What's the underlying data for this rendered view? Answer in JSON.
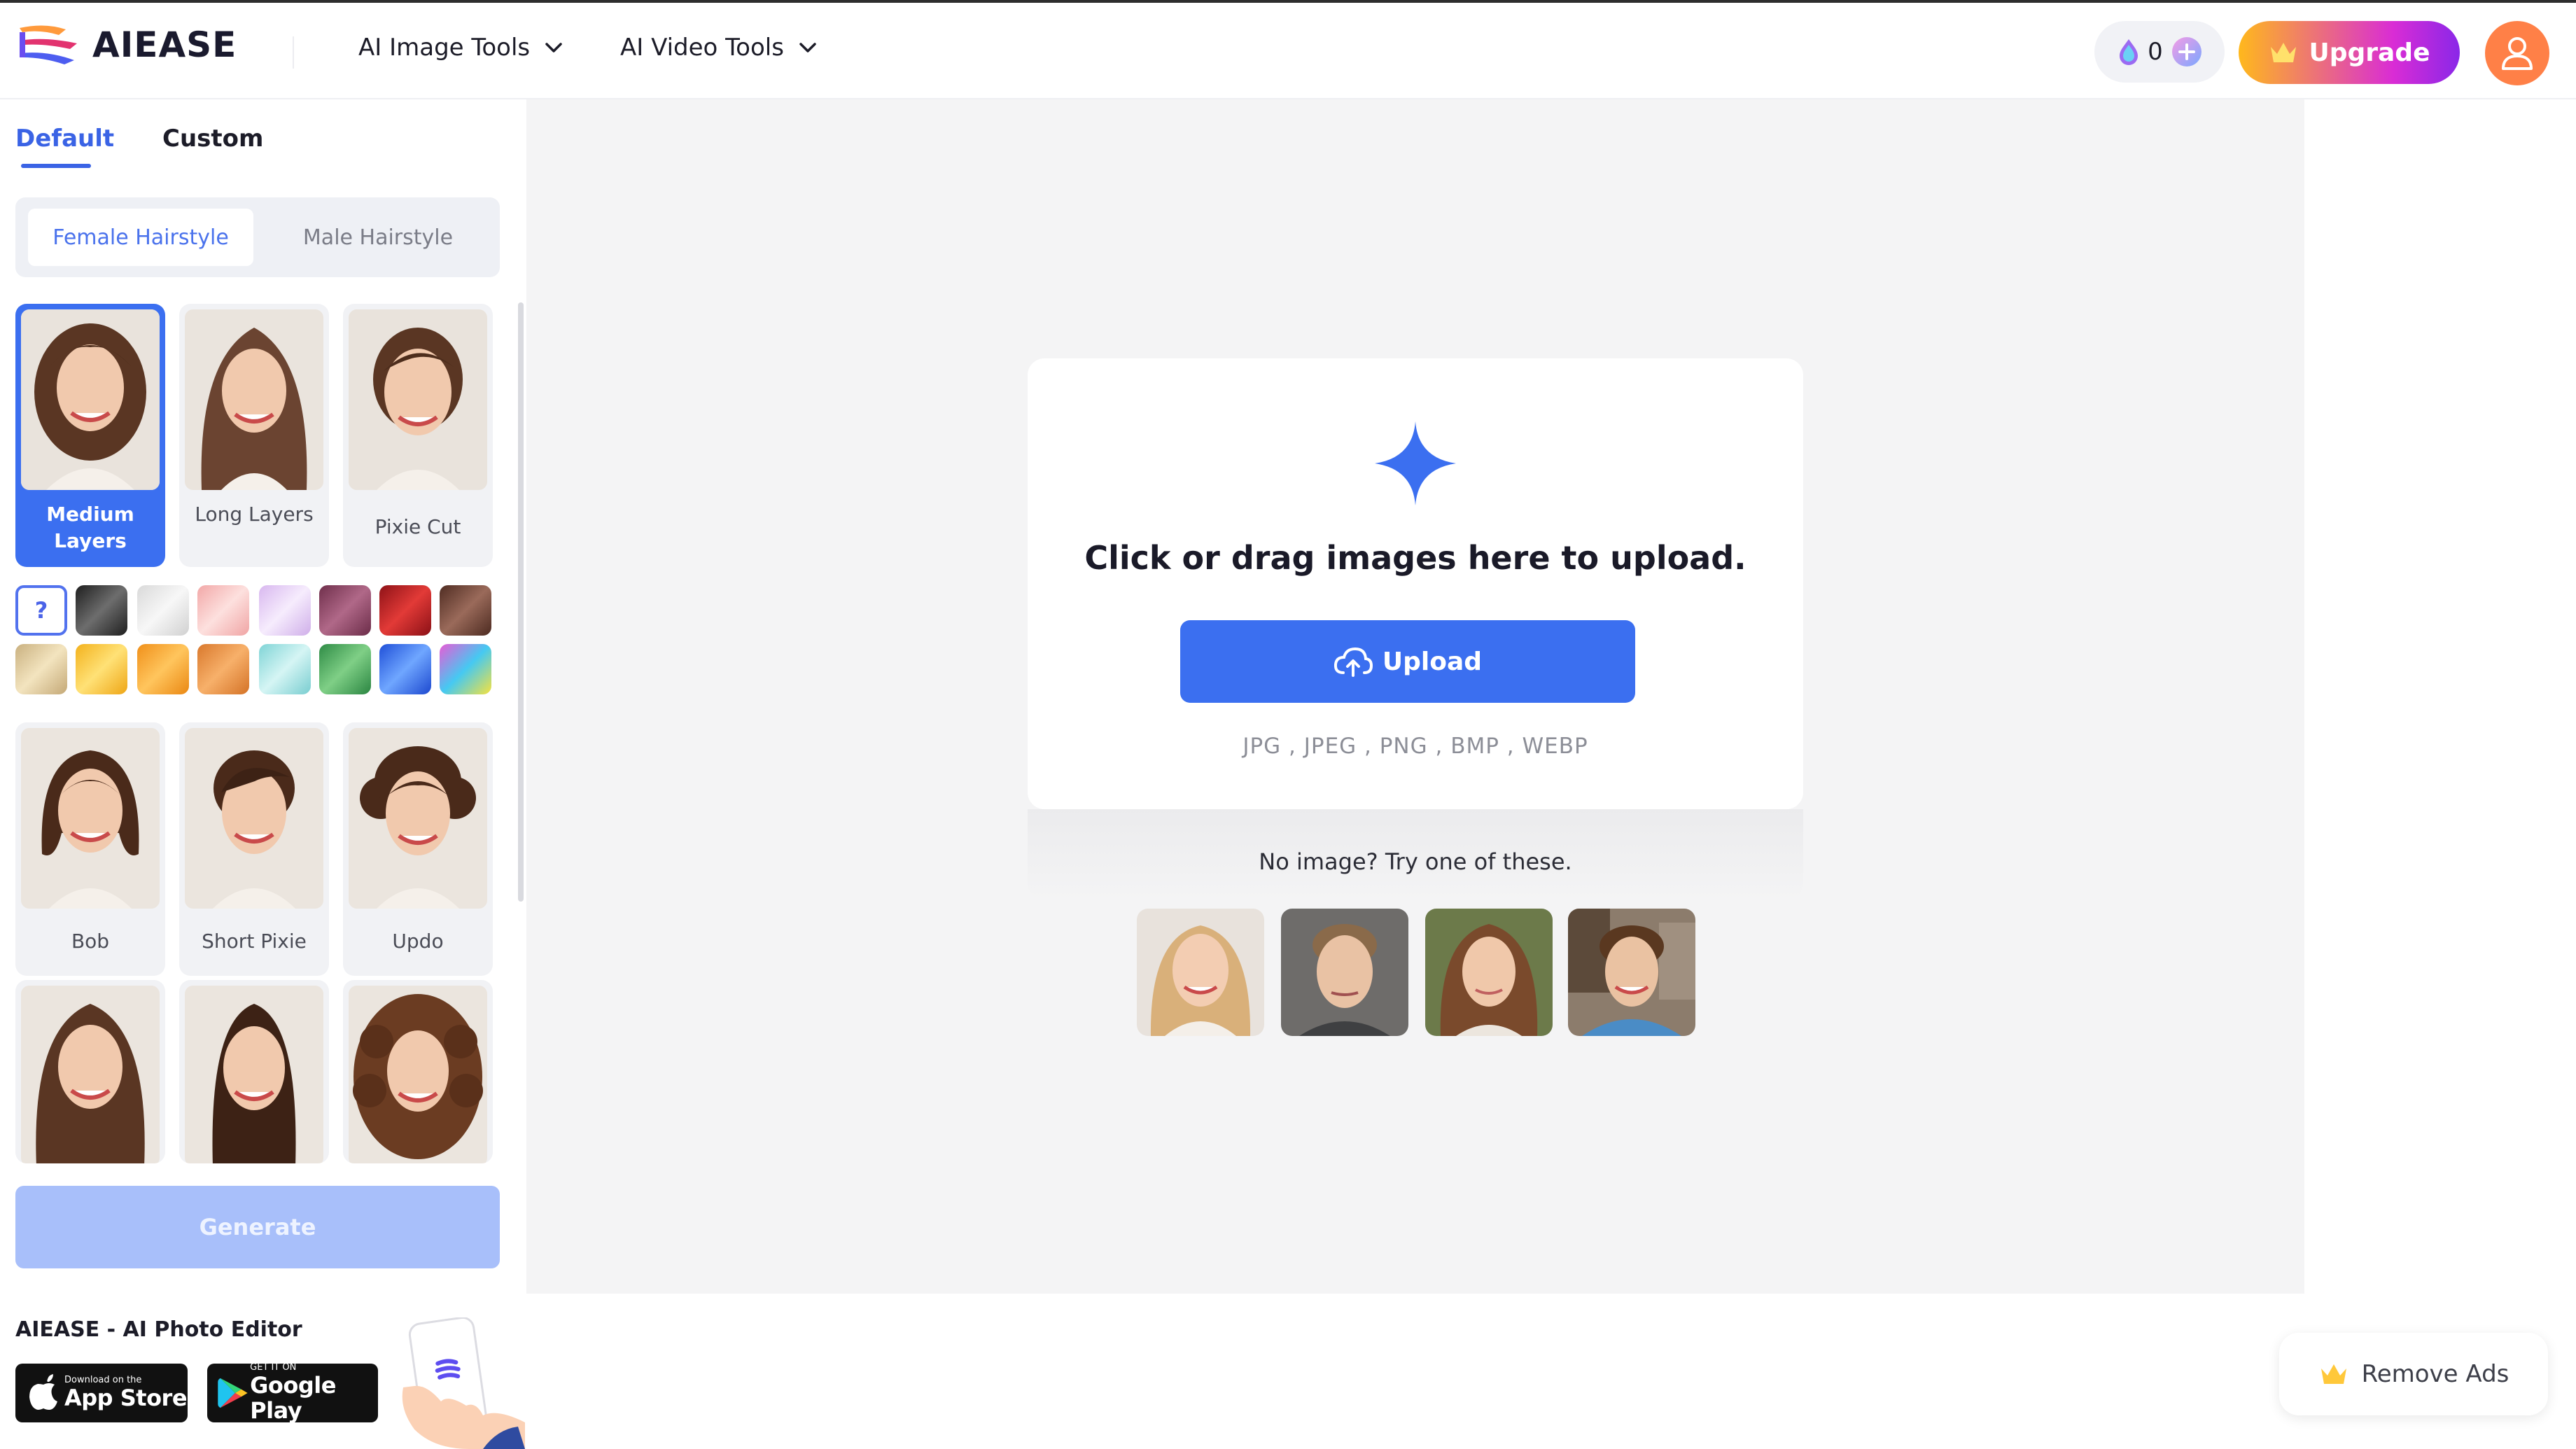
{
  "app": {
    "name": "AIEASE"
  },
  "header": {
    "nav": [
      {
        "label": "AI Image Tools"
      },
      {
        "label": "AI Video Tools"
      }
    ],
    "credits": "0",
    "upgrade_label": "Upgrade"
  },
  "sidebar": {
    "tabs": {
      "default": "Default",
      "custom": "Custom"
    },
    "segment": {
      "female": "Female Hairstyle",
      "male": "Male Hairstyle"
    },
    "styles": [
      {
        "label": "Medium Layers",
        "selected": true
      },
      {
        "label": "Long Layers"
      },
      {
        "label": "Pixie Cut"
      },
      {
        "label": "Bob"
      },
      {
        "label": "Short Pixie"
      },
      {
        "label": "Updo"
      },
      {
        "label": ""
      },
      {
        "label": ""
      },
      {
        "label": ""
      }
    ],
    "swatch_help": "?",
    "generate_label": "Generate",
    "promo": {
      "title": "AIEASE - AI Photo Editor",
      "app_store_small": "Download on the",
      "app_store_big": "App Store",
      "google_small": "GET IT ON",
      "google_big": "Google Play"
    }
  },
  "main": {
    "upload_title": "Click or drag images here to upload.",
    "upload_button": "Upload",
    "formats": "JPG , JPEG , PNG , BMP , WEBP",
    "samples_title": "No image? Try one of these."
  },
  "remove_ads_label": "Remove Ads"
}
